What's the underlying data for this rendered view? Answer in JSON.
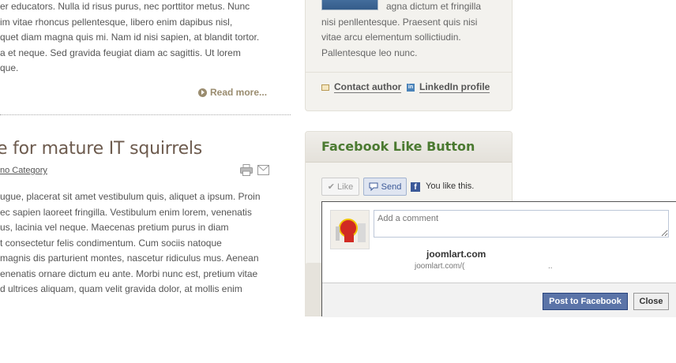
{
  "article": {
    "intro_lines": [
      "er educators. Nulla id risus purus, nec porttitor metus. Nunc",
      "im vitae rhoncus pellentesque, libero enim dapibus nisl,",
      "quet diam magna quis mi. Nam id nisi sapien, at blandit tortor.",
      "a et neque. Sed gravida feugiat diam ac sagittis. Ut lorem",
      "que."
    ],
    "read_more": "Read more...",
    "title": "e for mature IT squirrels",
    "category": "no Category",
    "body_lines": [
      "ugue, placerat sit amet vestibulum quis, aliquet a ipsum. Proin",
      "ec sapien laoreet fringilla. Vestibulum enim lorem, venenatis",
      "us, lacinia vel neque. Maecenas pretium purus in diam",
      "t consectetur felis condimentum. Cum sociis natoque",
      "magnis dis parturient montes, nascetur ridiculus mus. Aenean",
      "enenatis ornare dictum eu ante. Morbi nunc est, pretium vitae",
      "d ultrices aliquam, quam velit gravida dolor, at mollis enim"
    ]
  },
  "author": {
    "lines": [
      "agna dictum et fringilla",
      "nisi penllentesque. Praesent quis nisi",
      "vitae arcu elementum sollictiudin.",
      "Pallentesque leo nunc."
    ],
    "contact_label": "Contact author",
    "linkedin_label": "LinkedIn profile"
  },
  "fb_module": {
    "title": "Facebook Like Button",
    "like_label": "Like",
    "send_label": "Send",
    "you_like": "You like this."
  },
  "fb_popup": {
    "comment_placeholder": "Add a comment",
    "site_name": "joomlart.com",
    "site_url": "joomlart.com/(",
    "site_url_tail": "..",
    "post_label": "Post to Facebook",
    "close_label": "Close"
  },
  "colors": {
    "module_title": "#4b7a31",
    "article_title": "#6d5b4e",
    "facebook_blue": "#3b5998"
  }
}
